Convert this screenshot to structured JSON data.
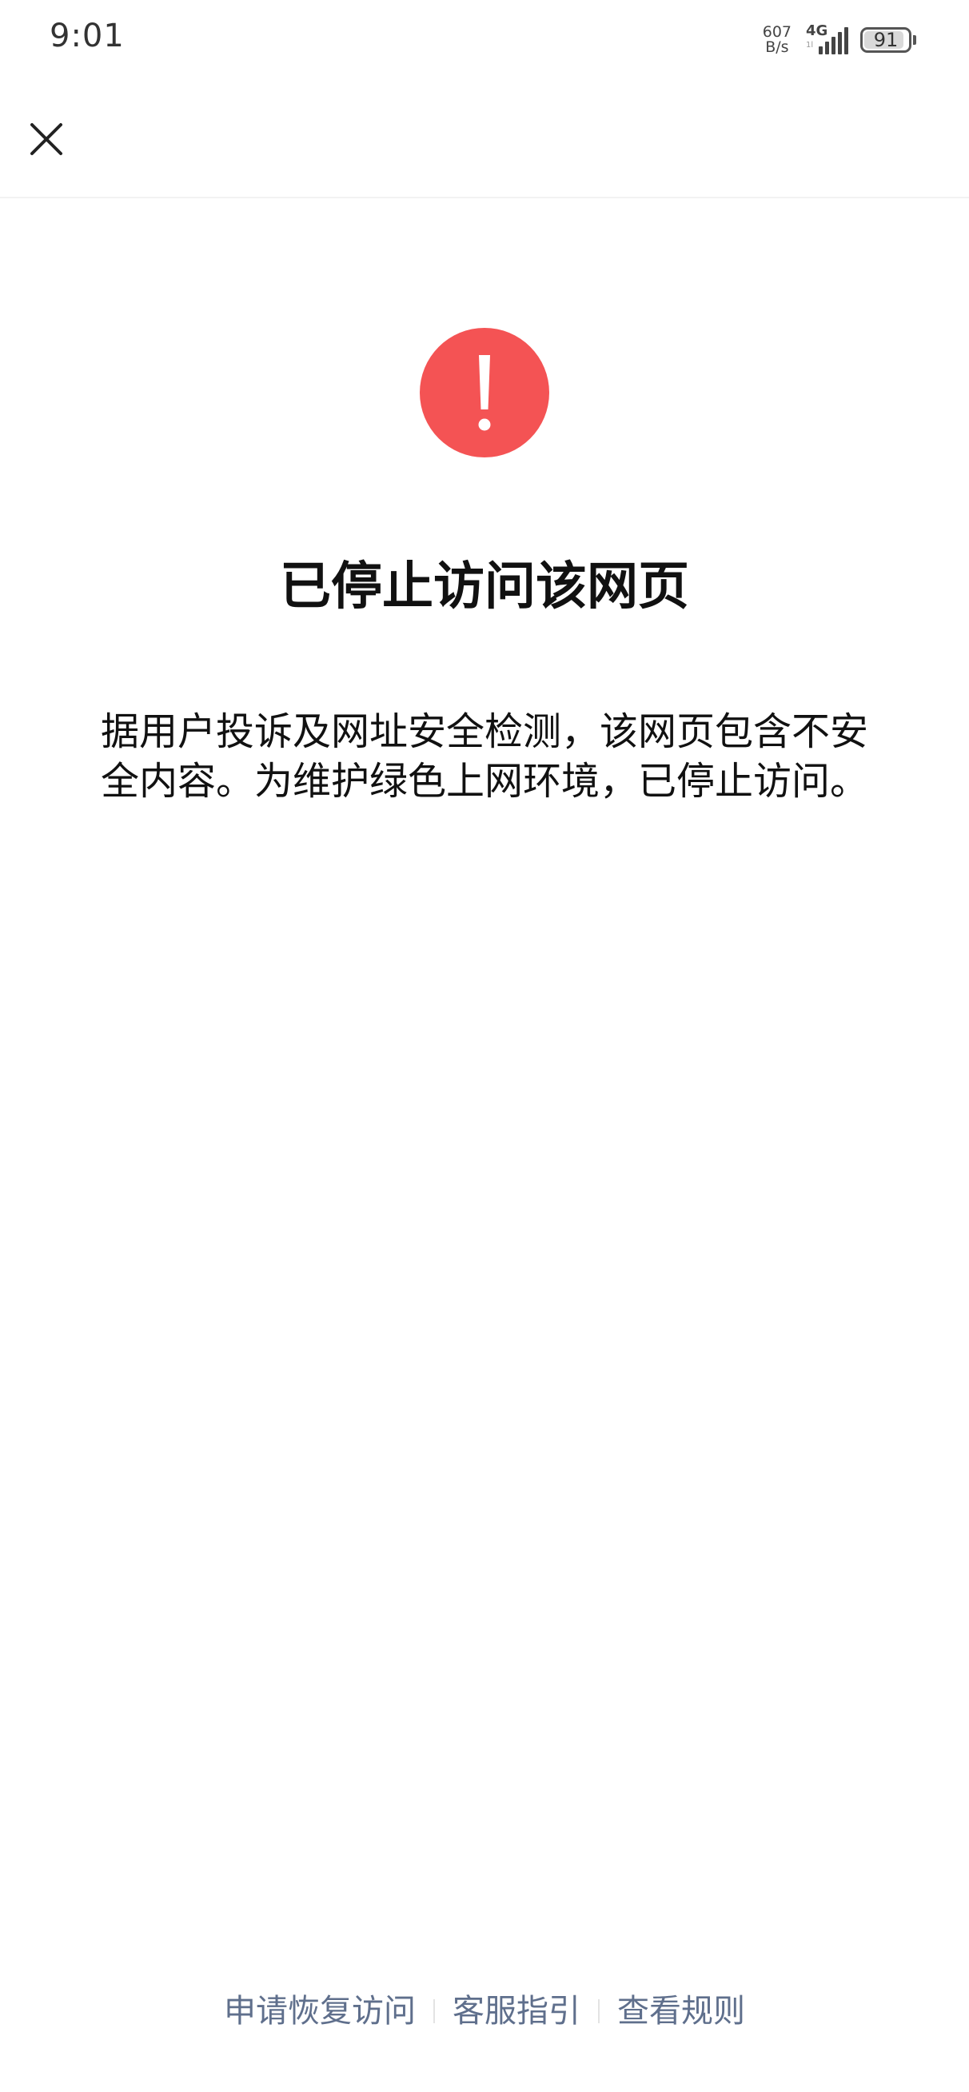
{
  "status_bar": {
    "time": "9:01",
    "net_speed_value": "607",
    "net_speed_unit": "B/s",
    "network_type": "4G",
    "network_sub": "1l",
    "battery_level": "91",
    "battery_fraction": 0.91
  },
  "nav": {
    "close_icon": "close-icon"
  },
  "main": {
    "icon": "exclamation-circle-icon",
    "icon_color": "#f45354",
    "title": "已停止访问该网页",
    "description": "据用户投诉及网址安全检测，该网页包含不安全内容。为维护绿色上网环境，已停止访问。"
  },
  "footer": {
    "links": [
      {
        "label": "申请恢复访问"
      },
      {
        "label": "客服指引"
      },
      {
        "label": "查看规则"
      }
    ],
    "link_color": "#5f6f8c"
  }
}
